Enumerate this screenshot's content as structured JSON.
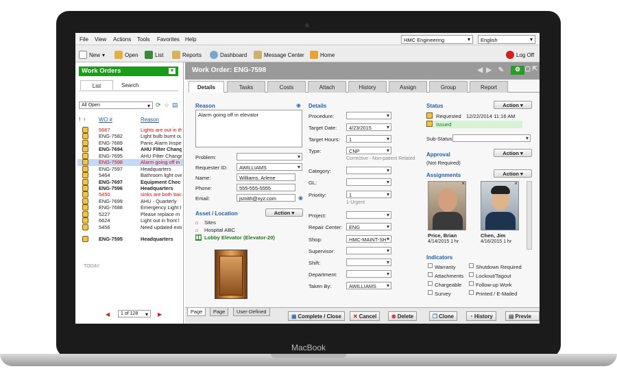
{
  "menubar": {
    "items": [
      "File",
      "View",
      "Actions",
      "Tools",
      "Favorites",
      "Help"
    ],
    "site_select": "HMC Engineering",
    "language_select": "English"
  },
  "toolbar": {
    "new": "New",
    "open": "Open",
    "list": "List",
    "reports": "Reports",
    "dashboard": "Dashboard",
    "message_center": "Message Center",
    "home": "Home",
    "logoff": "Log Off"
  },
  "left": {
    "header": "Work Orders",
    "tabs": [
      "List",
      "Search"
    ],
    "filter": "All Open",
    "col_wo": "WO #",
    "col_reason": "Reason",
    "rows": [
      {
        "id": "5667",
        "reason": "Lights are out in th",
        "style": "red"
      },
      {
        "id": "ENG-7582",
        "reason": "Light bulb burnt ou",
        "style": ""
      },
      {
        "id": "ENG-7689",
        "reason": "Panic Alarm Inspe",
        "style": ""
      },
      {
        "id": "ENG-7694",
        "reason": "AHU Filter Chang",
        "style": "bold"
      },
      {
        "id": "ENG-7695",
        "reason": "AHU Filter Change",
        "style": ""
      },
      {
        "id": "ENG-7598",
        "reason": "Alarm going off in",
        "style": "selected"
      },
      {
        "id": "ENG-7597",
        "reason": "Headquarters",
        "style": ""
      },
      {
        "id": "5464",
        "reason": "Bathroom light ove",
        "style": ""
      },
      {
        "id": "ENG-7697",
        "reason": "Equipment Chec",
        "style": "bold"
      },
      {
        "id": "ENG-7596",
        "reason": "Headquarters",
        "style": "bold"
      },
      {
        "id": "5450",
        "reason": "sinks are both bac",
        "style": "red"
      },
      {
        "id": "ENG-7699",
        "reason": "AHU - Quarterly",
        "style": ""
      },
      {
        "id": "ENG-7688",
        "reason": "Emergency Light I",
        "style": ""
      },
      {
        "id": "5227",
        "reason": "Please replace m",
        "style": ""
      },
      {
        "id": "6624",
        "reason": "Light out in front l",
        "style": ""
      },
      {
        "id": "5456",
        "reason": "Need updated exte",
        "style": ""
      },
      {
        "id": "ENG-7595",
        "reason": "Headquarters",
        "style": "bold"
      }
    ],
    "today_label": "TODAY",
    "pager": "1 of 128"
  },
  "main": {
    "title": "Work Order: ENG-7598",
    "tabs": [
      "Details",
      "Tasks",
      "Costs",
      "Attach",
      "History",
      "Assign",
      "Group",
      "Report"
    ],
    "reason_label": "Reason",
    "reason_text": "Alarm going off in elevator",
    "problem_label": "Problem:",
    "requester_label": "Requester ID:",
    "requester_value": "AWILLIAMS",
    "name_label": "Name:",
    "name_value": "Williams, Arlene",
    "phone_label": "Phone:",
    "phone_value": "555-555-5555",
    "email_label": "Email:",
    "email_value": "jsmith@xyz.com",
    "asset_label": "Asset / Location",
    "action_label": "Action",
    "asset_path": [
      "Sites",
      "Hospital ABC",
      "Lobby Elevator (Elevator-20)"
    ],
    "details_label": "Details",
    "procedure_label": "Procedure:",
    "target_date_label": "Target Date:",
    "target_date_value": "4/23/2015",
    "target_hours_label": "Target Hours:",
    "target_hours_value": "1",
    "type_label": "Type:",
    "type_value": "CNP",
    "type_desc": "Corrective - Non-patient Related",
    "category_label": "Category:",
    "gl_label": "GL:",
    "priority_label": "Priority:",
    "priority_value": "1",
    "priority_desc": "1-Urgent",
    "project_label": "Project:",
    "repair_center_label": "Repair Center:",
    "repair_center_value": "ENG",
    "shop_label": "Shop:",
    "shop_value": "HMC-MAINT-SH",
    "supervisor_label": "Supervisor:",
    "shift_label": "Shift:",
    "department_label": "Department:",
    "taken_by_label": "Taken By:",
    "taken_by_value": "AWILLIAMS",
    "status_label": "Status",
    "requested_label": "Requested",
    "requested_value": "12/22/2014 11:16 AM",
    "issued_label": "Issued",
    "substatus_label": "Sub-Status:",
    "approval_label": "Approval",
    "approval_value": "(Not Required)",
    "assignments_label": "Assignments",
    "assignee1_name": "Price, Brian",
    "assignee1_info": "4/14/2015  1 hr",
    "assignee2_name": "Chen, Jim",
    "assignee2_info": "4/16/2015  1 hr",
    "indicators_label": "Indicators",
    "indicators": [
      "Warranty",
      "Shutdown Required",
      "Attachments",
      "Lockout/Tagout",
      "Chargeable",
      "Follow-up Work",
      "Survey",
      "Printed / E-Mailed"
    ],
    "page_tabs": [
      "Page",
      "Page",
      "User-Defined"
    ]
  },
  "bottom": {
    "complete": "Complete / Close",
    "cancel": "Cancel",
    "delete": "Delete",
    "clone": "Clone",
    "history": "History",
    "preview": "Previe"
  },
  "device": {
    "brand": "MacBook"
  }
}
